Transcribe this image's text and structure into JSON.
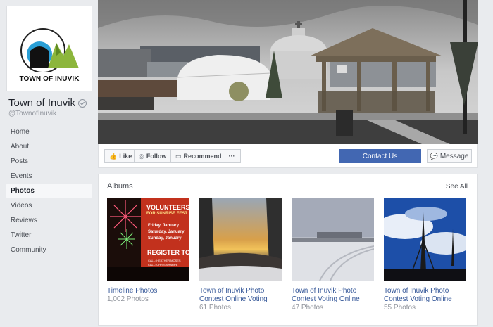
{
  "page": {
    "name": "Town of Inuvik",
    "handle": "@TownofInuvik",
    "logo_text": "TOWN OF INUVIK"
  },
  "nav": [
    {
      "label": "Home",
      "active": false
    },
    {
      "label": "About",
      "active": false
    },
    {
      "label": "Posts",
      "active": false
    },
    {
      "label": "Events",
      "active": false
    },
    {
      "label": "Photos",
      "active": true
    },
    {
      "label": "Videos",
      "active": false
    },
    {
      "label": "Reviews",
      "active": false
    },
    {
      "label": "Twitter",
      "active": false
    },
    {
      "label": "Community",
      "active": false
    }
  ],
  "actions": {
    "like": "Like",
    "follow": "Follow",
    "recommend": "Recommend",
    "more": "···",
    "contact": "Contact Us",
    "message": "Message"
  },
  "albums": {
    "title": "Albums",
    "see_all": "See All",
    "items": [
      {
        "title": "Timeline Photos",
        "count": "1,002 Photos"
      },
      {
        "title": "Town of Inuvik Photo Contest Online Voting",
        "count": "61 Photos"
      },
      {
        "title": "Town of Inuvik Photo Contest Voting Online",
        "count": "47 Photos"
      },
      {
        "title": "Town of Inuvik Photo Contest Voting Online",
        "count": "55 Photos"
      }
    ]
  },
  "poster": {
    "heading1": "VOLUNTEERS",
    "heading2": "FOR SUNRISE FEST",
    "line1": "Friday, January",
    "line2": "Saturday, January",
    "line3": "Sunday, January",
    "register": "REGISTER TO",
    "contact1": "CALL: HEATHER MOSES",
    "contact2": "CALL: CHRIS SHARPE"
  },
  "colors": {
    "brand_blue": "#4267b2",
    "link": "#365899",
    "logo_blue": "#2a9fd6",
    "logo_green": "#8cb63c"
  }
}
